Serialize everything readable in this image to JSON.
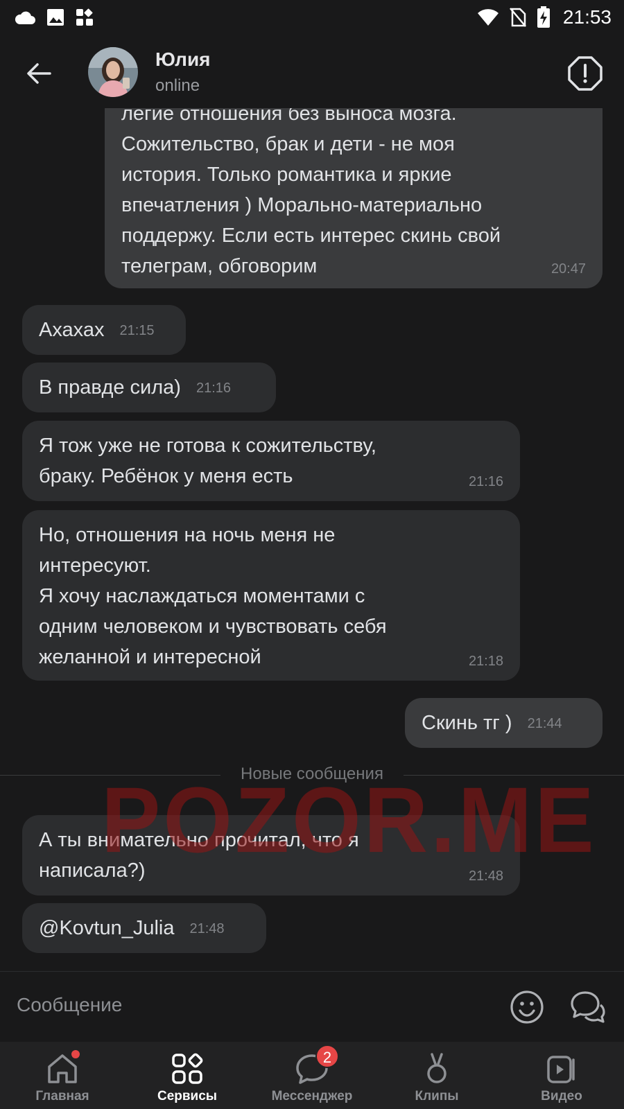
{
  "status_bar": {
    "time": "21:53",
    "left_icons": [
      "cloud-icon",
      "image-icon",
      "apps-icon"
    ],
    "right_icons": [
      "wifi-icon",
      "no-sim-icon",
      "battery-charging-icon"
    ]
  },
  "header": {
    "contact_name": "Юлия",
    "contact_status": "online",
    "back_icon": "arrow-left-icon",
    "report_icon": "alert-octagon-icon"
  },
  "messages": [
    {
      "direction": "out",
      "text": "легие отношения без выноса мозга.\nСожительство, брак и дети - не моя\nистория. Только романтика и яркие\nвпечатления ) Морально-материально\nподдержу. Если есть интерес скинь свой\nтелеграм, обговорим",
      "time": "20:47"
    },
    {
      "direction": "in",
      "text": "Ахахах",
      "time": "21:15"
    },
    {
      "direction": "in",
      "text": "В правде сила)",
      "time": "21:16"
    },
    {
      "direction": "in",
      "text": "Я тож уже не готова к сожительству,\nбраку. Ребёнок у меня есть",
      "time": "21:16"
    },
    {
      "direction": "in",
      "text": "Но, отношения на ночь меня не\nинтересуют.\nЯ хочу наслаждаться моментами с\nодним человеком и чувствовать себя\nжеланной и интересной",
      "time": "21:18"
    },
    {
      "direction": "out",
      "text": "Скинь тг )",
      "time": "21:44"
    },
    {
      "direction": "in",
      "text": "А ты внимательно прочитал, что я\nнаписала?)",
      "time": "21:48"
    },
    {
      "direction": "in",
      "text": "@Kovtun_Julia",
      "time": "21:48"
    }
  ],
  "divider_label": "Новые сообщения",
  "watermark": "POZOR.ME",
  "composer": {
    "placeholder": "Сообщение",
    "emoji_icon": "smile-icon",
    "voice_icon": "chat-bubbles-icon"
  },
  "bottom_nav": [
    {
      "label": "Главная",
      "icon": "home-icon",
      "dot_badge": true
    },
    {
      "label": "Сервисы",
      "icon": "services-icon",
      "active": true
    },
    {
      "label": "Мессенджер",
      "icon": "messenger-icon",
      "badge": "2"
    },
    {
      "label": "Клипы",
      "icon": "clips-icon"
    },
    {
      "label": "Видео",
      "icon": "video-icon"
    }
  ],
  "colors": {
    "background": "#19191a",
    "bubble_in": "#2c2d2f",
    "bubble_out": "#3a3b3d",
    "badge": "#e64646",
    "watermark": "#961414"
  }
}
